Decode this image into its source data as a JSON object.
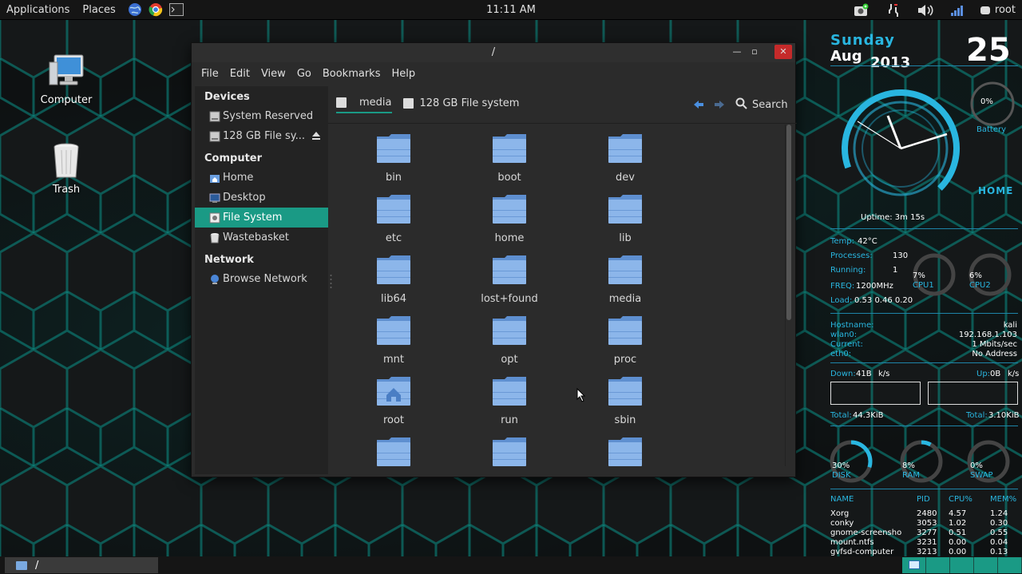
{
  "top_panel": {
    "applications_label": "Applications",
    "places_label": "Places",
    "clock": "11:11 AM",
    "user": "root"
  },
  "desktop_icons": [
    {
      "label": "Computer"
    },
    {
      "label": "Trash"
    }
  ],
  "window": {
    "title": "/",
    "menu": [
      "File",
      "Edit",
      "View",
      "Go",
      "Bookmarks",
      "Help"
    ],
    "sidebar": {
      "devices_header": "Devices",
      "devices": [
        {
          "label": "System Reserved"
        },
        {
          "label": "128 GB File sy..."
        }
      ],
      "computer_header": "Computer",
      "computer": [
        {
          "label": "Home"
        },
        {
          "label": "Desktop"
        },
        {
          "label": "File System"
        },
        {
          "label": "Wastebasket"
        }
      ],
      "network_header": "Network",
      "network": [
        {
          "label": "Browse Network"
        }
      ]
    },
    "pathbar": {
      "crumbs": [
        "media",
        "128 GB File system"
      ],
      "search_label": "Search"
    },
    "files": [
      "bin",
      "boot",
      "dev",
      "etc",
      "home",
      "lib",
      "lib64",
      "lost+found",
      "media",
      "mnt",
      "opt",
      "proc",
      "root",
      "run",
      "sbin",
      "",
      "",
      ""
    ]
  },
  "conky": {
    "day": "Sunday",
    "month_year_a": "Aug",
    "month_year_b": "2013",
    "date": "25",
    "battery_pct": "0%",
    "battery_label": "Battery",
    "home_label": "HOME",
    "uptime": "Uptime: 3m 15s",
    "temp_label": "Temp:",
    "temp_value": "42°C",
    "processes_label": "Processes:",
    "processes_value": "130",
    "running_label": "Running:",
    "running_value": "1",
    "freq_label": "FREQ:",
    "freq_value": "1200MHz",
    "load_label": "Load:",
    "load_value": "0.53 0.46 0.20",
    "cpu1_pct": "7%",
    "cpu1_label": "CPU1",
    "cpu2_pct": "6%",
    "cpu2_label": "CPU2",
    "hostname_label": "Hostname:",
    "hostname_value": "kali",
    "wlan_label": "wlan0:",
    "wlan_value": "192.168.1.103",
    "current_label": "Current:",
    "current_value": "1  Mbits/sec",
    "eth_label": "eth0:",
    "eth_value": "No Address",
    "down_label": "Down:",
    "down_value": "41B",
    "down_unit": "k/s",
    "up_label": "Up:",
    "up_value": "0B",
    "up_unit": "k/s",
    "total_down_label": "Total:",
    "total_down_value": "44.3KiB",
    "total_up_label": "Total:",
    "total_up_value": "3.10KiB",
    "disk_pct": "30%",
    "disk_label": "DISK",
    "ram_pct": "8%",
    "ram_label": "RAM",
    "swap_pct": "0%",
    "swap_label": "SWAP",
    "proc_headers": [
      "NAME",
      "PID",
      "CPU%",
      "MEM%"
    ],
    "processes": [
      {
        "name": "Xorg",
        "pid": "2480",
        "cpu": "4.57",
        "mem": "1.24"
      },
      {
        "name": "conky",
        "pid": "3053",
        "cpu": "1.02",
        "mem": "0.30"
      },
      {
        "name": "gnome-screensho",
        "pid": "3277",
        "cpu": "0.51",
        "mem": "0.55"
      },
      {
        "name": "mount.ntfs",
        "pid": "3231",
        "cpu": "0.00",
        "mem": "0.04"
      },
      {
        "name": "gvfsd-computer",
        "pid": "3213",
        "cpu": "0.00",
        "mem": "0.13"
      }
    ],
    "gauges": {
      "battery": 0,
      "cpu1": 0.07,
      "cpu2": 0.06,
      "disk": 0.3,
      "ram": 0.08,
      "swap": 0
    }
  },
  "bottom_panel": {
    "task_label": "/"
  },
  "colors": {
    "accent": "#1a9a85",
    "conky": "#29b6e0",
    "folder": "#7aa9e0"
  }
}
